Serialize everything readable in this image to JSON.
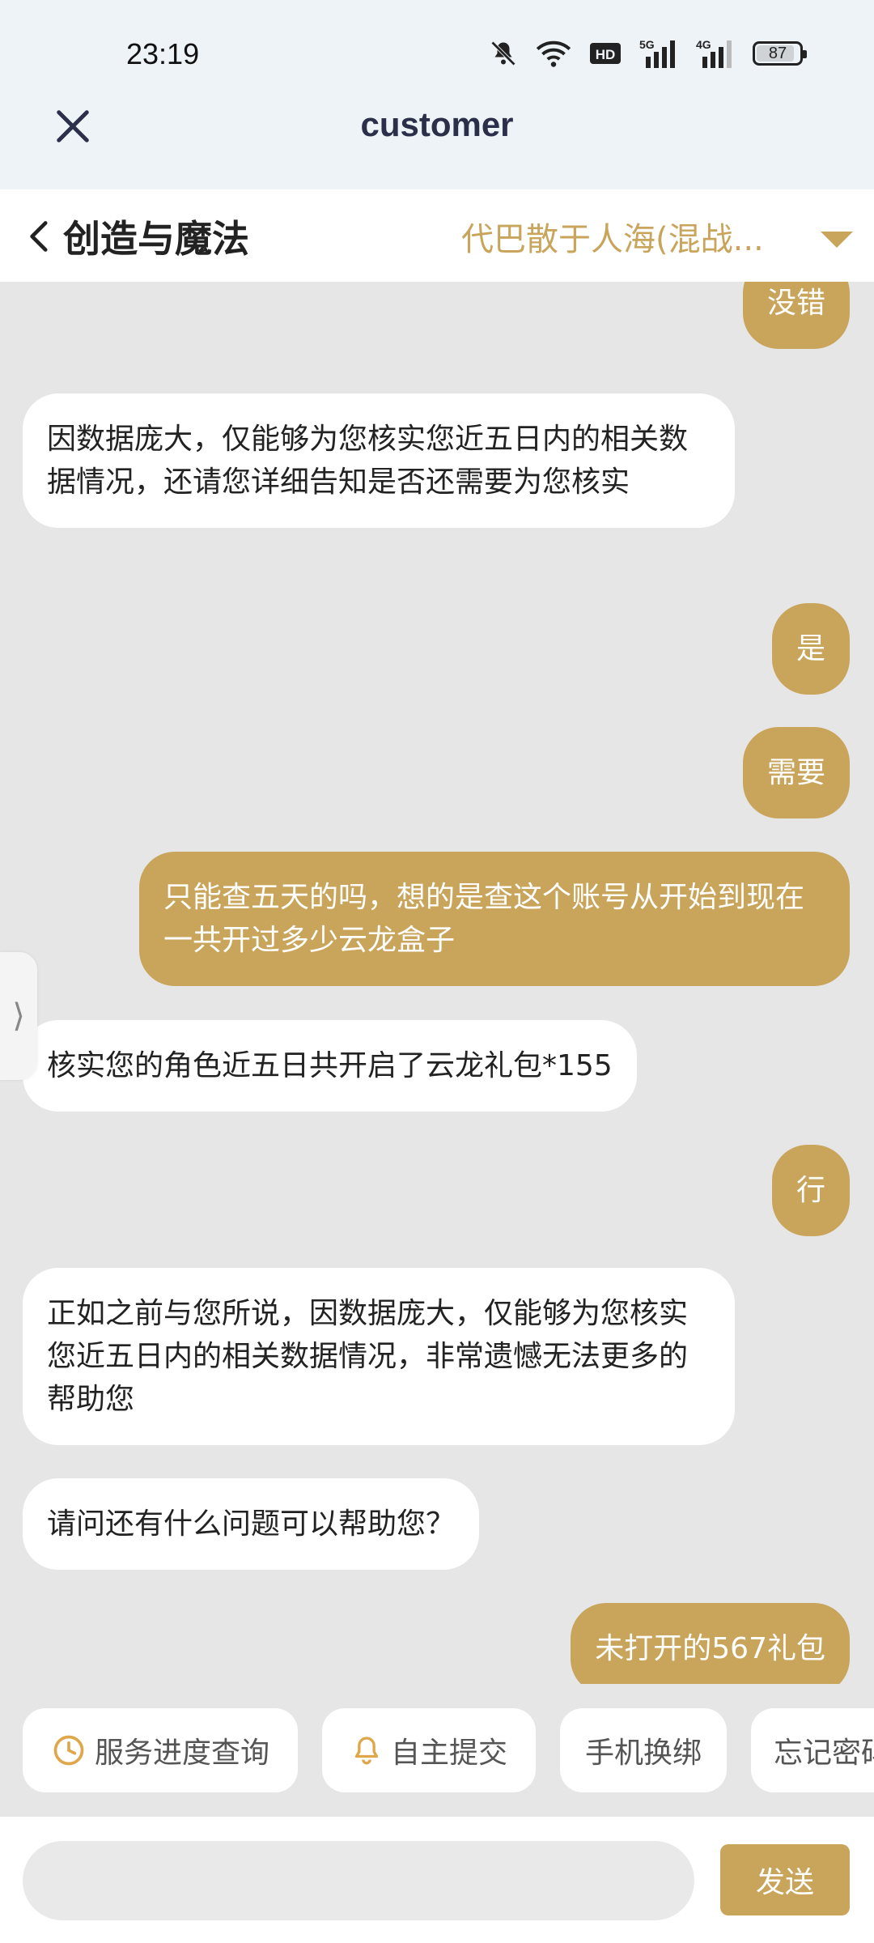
{
  "status_bar": {
    "time": "23:19",
    "network_label": "HD",
    "sim1_label": "5G",
    "sim2_label": "4G",
    "battery": "87"
  },
  "header": {
    "title": "customer"
  },
  "subheader": {
    "back_label": "创造与魔法",
    "server_label": "代巴散于人海(混战..."
  },
  "messages": [
    {
      "from": "me",
      "text": "没错"
    },
    {
      "from": "bot",
      "text": "因数据庞大，仅能够为您核实您近五日内的相关数据情况，还请您详细告知是否还需要为您核实"
    },
    {
      "from": "me",
      "text": "是"
    },
    {
      "from": "me",
      "text": "需要"
    },
    {
      "from": "me",
      "text": "只能查五天的吗，想的是查这个账号从开始到现在一共开过多少云龙盒子"
    },
    {
      "from": "bot",
      "text": "核实您的角色近五日共开启了云龙礼包*155"
    },
    {
      "from": "me",
      "text": "行"
    },
    {
      "from": "bot",
      "text": "正如之前与您所说，因数据庞大，仅能够为您核实您近五日内的相关数据情况，非常遗憾无法更多的帮助您"
    },
    {
      "from": "bot",
      "text": "请问还有什么问题可以帮助您？"
    },
    {
      "from": "me",
      "text": "未打开的567礼包"
    }
  ],
  "side_tab": {
    "glyph": "⟩"
  },
  "quick_actions": [
    {
      "label": "服务进度查询",
      "icon": "clock-icon"
    },
    {
      "label": "自主提交",
      "icon": "bell-icon"
    },
    {
      "label": "手机换绑",
      "icon": ""
    },
    {
      "label": "忘记密码",
      "icon": ""
    }
  ],
  "input": {
    "value": "",
    "placeholder": "",
    "send_label": "发送"
  },
  "colors": {
    "accent": "#c9a55c",
    "background": "#e6e6e6",
    "top_bar": "#eef3f7",
    "title": "#2b2f4a"
  }
}
